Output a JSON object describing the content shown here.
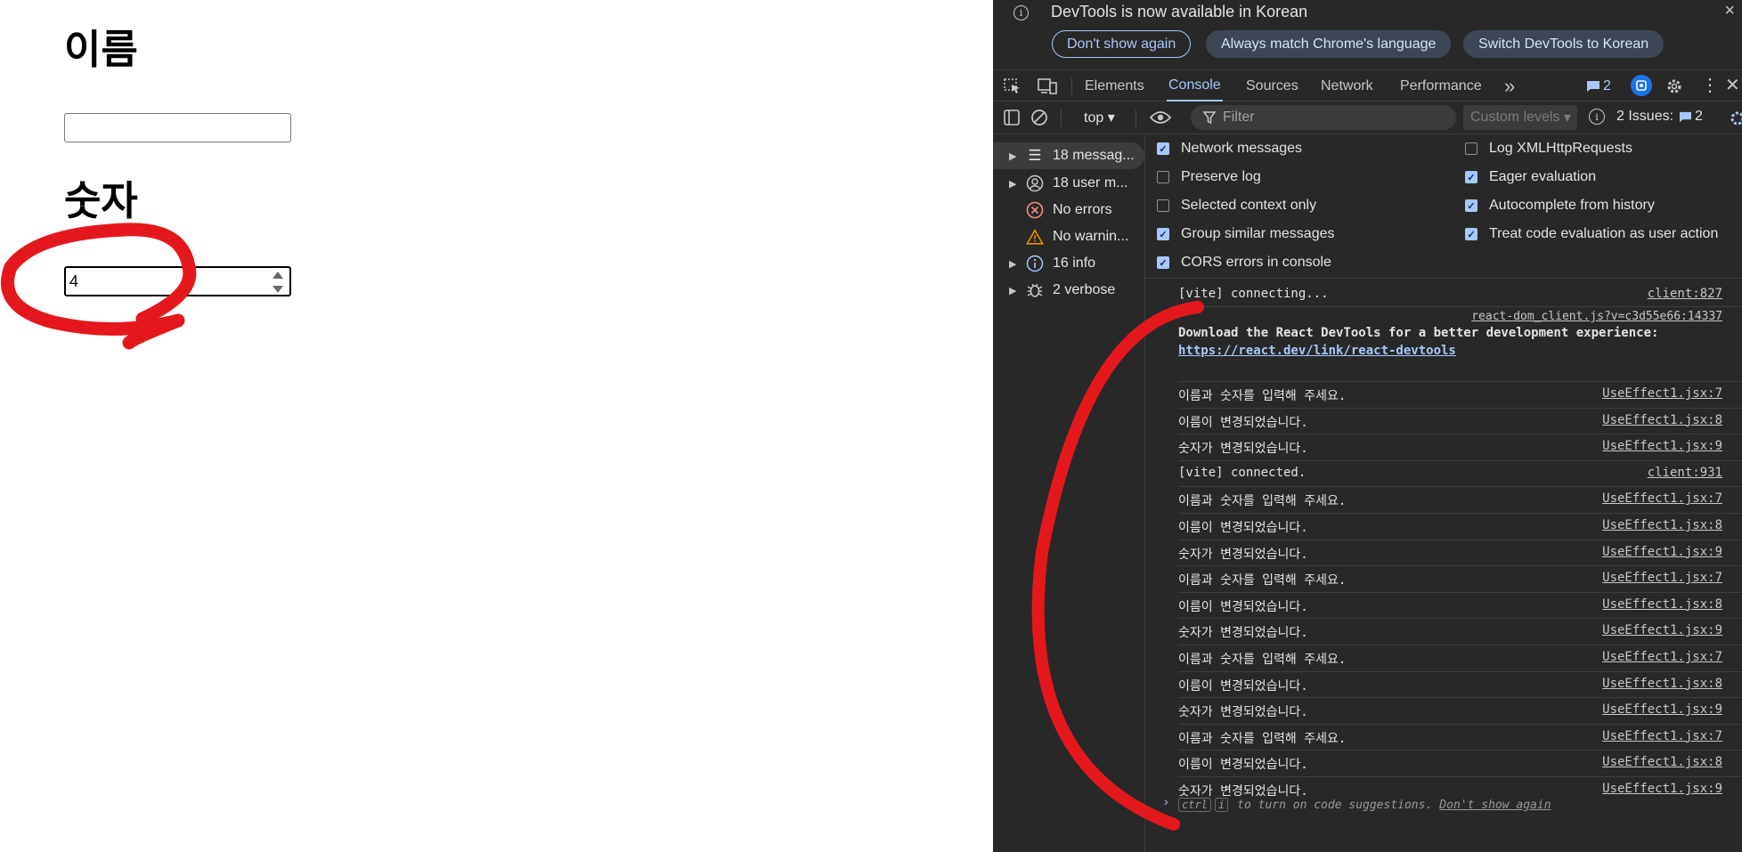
{
  "page": {
    "name_heading": "이름",
    "name_value": "",
    "number_heading": "숫자",
    "number_value": "4"
  },
  "devtools": {
    "infobar": {
      "message": "DevTools is now available in Korean",
      "btn_dont_show": "Don't show again",
      "btn_match": "Always match Chrome's language",
      "btn_switch": "Switch DevTools to Korean",
      "close": "×"
    },
    "tabs": [
      "Elements",
      "Console",
      "Sources",
      "Network",
      "Performance"
    ],
    "more_tabs": "»",
    "message_count": "2",
    "toolbar": {
      "context": "top",
      "filter_placeholder": "Filter",
      "levels": "Custom levels",
      "issues_label": "2 Issues:",
      "issues_count": "2"
    },
    "sidebar": [
      {
        "label": "18 messag...",
        "icon": "list-icon"
      },
      {
        "label": "18 user m...",
        "icon": "user-icon"
      },
      {
        "label": "No errors",
        "icon": "error-icon"
      },
      {
        "label": "No warnin...",
        "icon": "warning-icon"
      },
      {
        "label": "16 info",
        "icon": "info-icon"
      },
      {
        "label": "2 verbose",
        "icon": "bug-icon"
      }
    ],
    "settings": {
      "left": [
        {
          "label": "Network messages",
          "checked": true
        },
        {
          "label": "Preserve log",
          "checked": false
        },
        {
          "label": "Selected context only",
          "checked": false
        },
        {
          "label": "Group similar messages",
          "checked": true
        },
        {
          "label": "CORS errors in console",
          "checked": true
        }
      ],
      "right": [
        {
          "label": "Log XMLHttpRequests",
          "checked": false
        },
        {
          "label": "Eager evaluation",
          "checked": true
        },
        {
          "label": "Autocomplete from history",
          "checked": true
        },
        {
          "label": "Treat code evaluation as user action",
          "checked": true
        }
      ]
    },
    "console": {
      "vite_connecting": {
        "msg": "[vite] connecting...",
        "src": "client:827"
      },
      "react": {
        "src": "react-dom_client.js?v=c3d55e66:14337",
        "msg": "Download the React DevTools for a better development experience:",
        "link": "https://react.dev/link/react-devtools"
      },
      "rows": [
        {
          "msg": "이름과 숫자를 입력해 주세요.",
          "src": "UseEffect1.jsx:7"
        },
        {
          "msg": "이름이 변경되었습니다.",
          "src": "UseEffect1.jsx:8"
        },
        {
          "msg": "숫자가 변경되었습니다.",
          "src": "UseEffect1.jsx:9"
        },
        {
          "msg": "[vite] connected.",
          "src": "client:931"
        },
        {
          "msg": "이름과 숫자를 입력해 주세요.",
          "src": "UseEffect1.jsx:7"
        },
        {
          "msg": "이름이 변경되었습니다.",
          "src": "UseEffect1.jsx:8"
        },
        {
          "msg": "숫자가 변경되었습니다.",
          "src": "UseEffect1.jsx:9"
        },
        {
          "msg": "이름과 숫자를 입력해 주세요.",
          "src": "UseEffect1.jsx:7"
        },
        {
          "msg": "이름이 변경되었습니다.",
          "src": "UseEffect1.jsx:8"
        },
        {
          "msg": "숫자가 변경되었습니다.",
          "src": "UseEffect1.jsx:9"
        },
        {
          "msg": "이름과 숫자를 입력해 주세요.",
          "src": "UseEffect1.jsx:7"
        },
        {
          "msg": "이름이 변경되었습니다.",
          "src": "UseEffect1.jsx:8"
        },
        {
          "msg": "숫자가 변경되었습니다.",
          "src": "UseEffect1.jsx:9"
        },
        {
          "msg": "이름과 숫자를 입력해 주세요.",
          "src": "UseEffect1.jsx:7"
        },
        {
          "msg": "이름이 변경되었습니다.",
          "src": "UseEffect1.jsx:8"
        },
        {
          "msg": "숫자가 변경되었습니다.",
          "src": "UseEffect1.jsx:9"
        }
      ],
      "hint": {
        "key1": "ctrl",
        "key2": "i",
        "text": "to turn on code suggestions.",
        "dont_show": "Don't show again"
      }
    }
  },
  "colors": {
    "annotation": "#e4181c",
    "accent": "#a8c7fa"
  }
}
